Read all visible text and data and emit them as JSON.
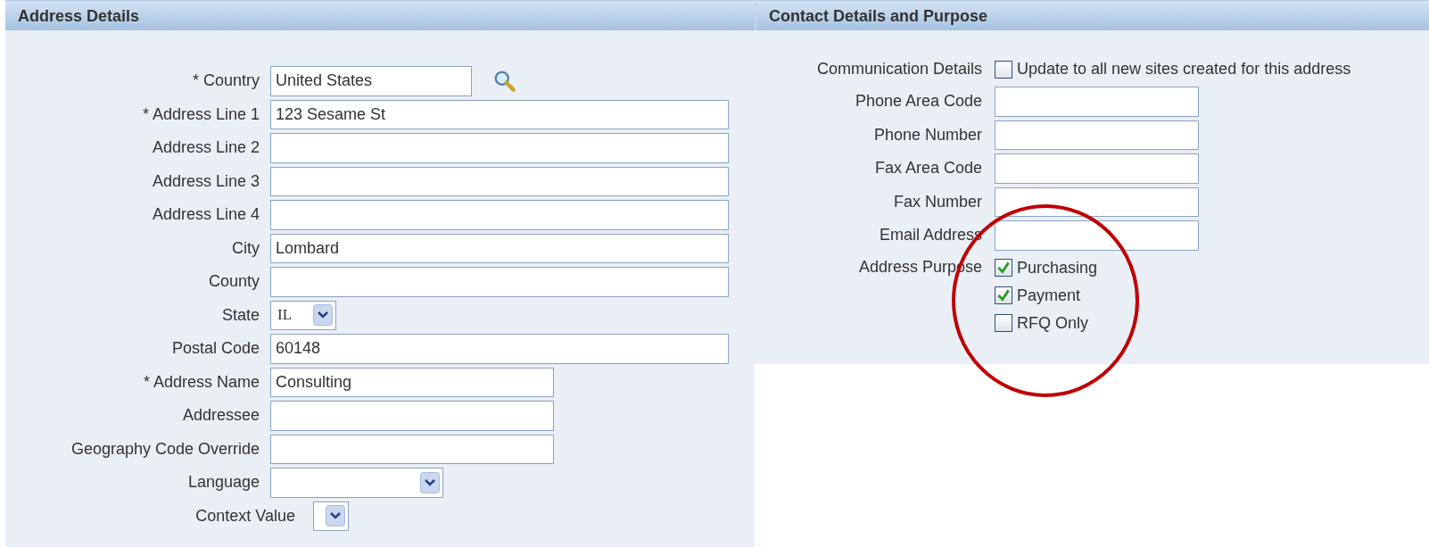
{
  "address_details": {
    "title": "Address Details",
    "fields": [
      {
        "label": "* Country",
        "kind": "lookup",
        "value": "United States"
      },
      {
        "label": "* Address Line 1",
        "kind": "text",
        "value": "123 Sesame St"
      },
      {
        "label": "Address Line 2",
        "kind": "text"
      },
      {
        "label": "Address Line 3",
        "kind": "text"
      },
      {
        "label": "Address Line 4",
        "kind": "text"
      },
      {
        "label": "City",
        "kind": "text",
        "value": "Lombard"
      },
      {
        "label": "County",
        "kind": "text"
      },
      {
        "label": "State",
        "kind": "select",
        "value": "IL"
      },
      {
        "label": "Postal Code",
        "kind": "text",
        "value": "60148"
      },
      {
        "label": "* Address Name",
        "kind": "text",
        "value": "Consulting"
      },
      {
        "label": "Addressee",
        "kind": "text"
      },
      {
        "label": "Geography Code Override",
        "kind": "text"
      },
      {
        "label": "Language",
        "kind": "select"
      },
      {
        "label": "Context Value",
        "kind": "select"
      }
    ]
  },
  "contact_details": {
    "title": "Contact Details and Purpose",
    "communication": {
      "label": "Communication Details",
      "option": "Update to all new sites created for this address",
      "checked": false
    },
    "fields": [
      {
        "label": "Phone Area Code"
      },
      {
        "label": "Phone Number"
      },
      {
        "label": "Fax Area Code"
      },
      {
        "label": "Fax Number"
      },
      {
        "label": "Email Address"
      }
    ],
    "purpose": {
      "label": "Address Purpose",
      "options": [
        {
          "label": "Purchasing",
          "checked": true
        },
        {
          "label": "Payment",
          "checked": true
        },
        {
          "label": "RFQ Only",
          "checked": false
        }
      ]
    }
  },
  "annotation": {
    "kind": "circle"
  }
}
